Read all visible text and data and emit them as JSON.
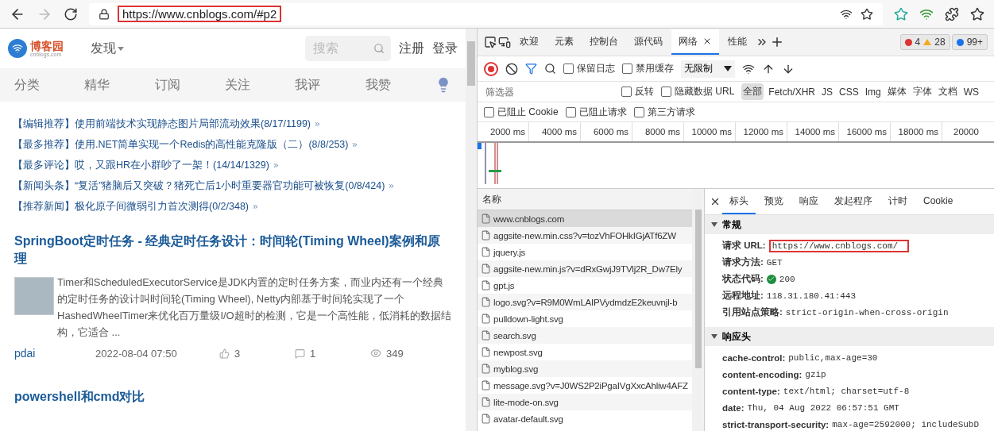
{
  "browser": {
    "url": "https://www.cnblogs.com/#p2"
  },
  "page": {
    "logo": {
      "name": "博客园",
      "sub": "cnblogs.com"
    },
    "discover": "发现",
    "search": {
      "placeholder": "搜索"
    },
    "auth_links": [
      "注册",
      "登录"
    ],
    "categories": [
      "分类",
      "精华",
      "订阅",
      "关注",
      "我评",
      "我赞"
    ],
    "featured": [
      {
        "tag": "【编辑推荐】",
        "text": "使用前端技术实现静态图片局部流动效果(8/17/1199)"
      },
      {
        "tag": "【最多推荐】",
        "text": "使用.NET简单实现一个Redis的高性能克隆版（二）(8/8/253)"
      },
      {
        "tag": "【最多评论】",
        "text": "哎，又跟HR在小群吵了一架！(14/14/1329)"
      },
      {
        "tag": "【新闻头条】",
        "text": "“复活”猪脑后又突破？猪死亡后1小时重要器官功能可被恢复(0/8/424)"
      },
      {
        "tag": "【推荐新闻】",
        "text": "极化原子间微弱引力首次测得(0/2/348)"
      }
    ],
    "articles": [
      {
        "title": "SpringBoot定时任务 - 经典定时任务设计：时间轮(Timing Wheel)案例和原理",
        "summary": "Timer和ScheduledExecutorService是JDK内置的定时任务方案，而业内还有一个经典的定时任务的设计叫时间轮(Timing Wheel), Netty内部基于时间轮实现了一个HashedWheelTimer来优化百万量级I/O超时的检测，它是一个高性能，低消耗的数据结构，它适合 ...",
        "author": "pdai",
        "date": "2022-08-04 07:50",
        "likes": "3",
        "comments": "1",
        "views": "349"
      },
      {
        "title": "powershell和cmd对比"
      }
    ]
  },
  "devtools": {
    "tabs": [
      {
        "label": "欢迎",
        "selected": false
      },
      {
        "label": "元素",
        "selected": false
      },
      {
        "label": "控制台",
        "selected": false
      },
      {
        "label": "源代码",
        "selected": false
      },
      {
        "label": "网络",
        "selected": true
      },
      {
        "label": "性能",
        "selected": false
      }
    ],
    "errors": "4",
    "warnings": "28",
    "messages": "99+",
    "toolbar_checks": [
      {
        "label": "保留日志",
        "checked": false
      },
      {
        "label": "禁用缓存",
        "checked": false
      }
    ],
    "throttle": "无限制",
    "filter": {
      "placeholder": "筛选器"
    },
    "filter_checks": [
      {
        "label": "反转",
        "checked": false
      },
      {
        "label": "隐藏数据 URL",
        "checked": false
      }
    ],
    "types": [
      {
        "label": "全部",
        "selected": true
      },
      {
        "label": "Fetch/XHR",
        "selected": false
      },
      {
        "label": "JS",
        "selected": false
      },
      {
        "label": "CSS",
        "selected": false
      },
      {
        "label": "Img",
        "selected": false
      },
      {
        "label": "媒体",
        "selected": false
      },
      {
        "label": "字体",
        "selected": false
      },
      {
        "label": "文档",
        "selected": false
      },
      {
        "label": "WS",
        "selected": false
      }
    ],
    "block_checks": [
      {
        "label": "已阻止 Cookie",
        "checked": false
      },
      {
        "label": "已阻止请求",
        "checked": false
      },
      {
        "label": "第三方请求",
        "checked": false
      }
    ],
    "timeline_ticks": [
      "2000 ms",
      "4000 ms",
      "6000 ms",
      "8000 ms",
      "10000 ms",
      "12000 ms",
      "14000 ms",
      "16000 ms",
      "18000 ms",
      "20000"
    ],
    "name_header": "名称",
    "requests": [
      {
        "name": "www.cnblogs.com",
        "selected": true
      },
      {
        "name": "aggsite-new.min.css?v=tozVhFOHkIGjATf6ZW",
        "selected": false
      },
      {
        "name": "jquery.js",
        "selected": false
      },
      {
        "name": "aggsite-new.min.js?v=dRxGwjJ9TVlj2R_Dw7Ely",
        "selected": false
      },
      {
        "name": "gpt.js",
        "selected": false
      },
      {
        "name": "logo.svg?v=R9M0WmLAIPVydmdzE2keuvnjl-b",
        "selected": false
      },
      {
        "name": "pulldown-light.svg",
        "selected": false
      },
      {
        "name": "search.svg",
        "selected": false
      },
      {
        "name": "newpost.svg",
        "selected": false
      },
      {
        "name": "myblog.svg",
        "selected": false
      },
      {
        "name": "message.svg?v=J0WS2P2iPgaIVgXxcAhliw4AFZ",
        "selected": false
      },
      {
        "name": "lite-mode-on.svg",
        "selected": false
      },
      {
        "name": "avatar-default.svg",
        "selected": false
      }
    ],
    "detail_tabs": [
      {
        "label": "标头",
        "selected": true
      },
      {
        "label": "预览",
        "selected": false
      },
      {
        "label": "响应",
        "selected": false
      },
      {
        "label": "发起程序",
        "selected": false
      },
      {
        "label": "计时",
        "selected": false
      },
      {
        "label": "Cookie",
        "selected": false
      }
    ],
    "sections": [
      {
        "title": "常规",
        "expanded": true,
        "rows": [
          {
            "key": "请求 URL:",
            "value": "https://www.cnblogs.com/",
            "highlighted": true
          },
          {
            "key": "请求方法:",
            "value": "GET",
            "highlighted": false
          },
          {
            "key": "状态代码:",
            "value": "200",
            "highlighted": false,
            "kind": "status"
          },
          {
            "key": "远程地址:",
            "value": "118.31.180.41:443",
            "highlighted": false
          },
          {
            "key": "引用站点策略:",
            "value": "strict-origin-when-cross-origin",
            "highlighted": false
          }
        ]
      },
      {
        "title": "响应头",
        "expanded": true,
        "rows": [
          {
            "key": "cache-control:",
            "value": "public,max-age=30",
            "highlighted": false
          },
          {
            "key": "content-encoding:",
            "value": "gzip",
            "highlighted": false
          },
          {
            "key": "content-type:",
            "value": "text/html; charset=utf-8",
            "highlighted": false
          },
          {
            "key": "date:",
            "value": "Thu, 04 Aug 2022 06:57:51 GMT",
            "highlighted": false
          },
          {
            "key": "strict-transport-security:",
            "value": "max-age=2592000; includeSubD",
            "highlighted": false
          }
        ]
      }
    ]
  }
}
